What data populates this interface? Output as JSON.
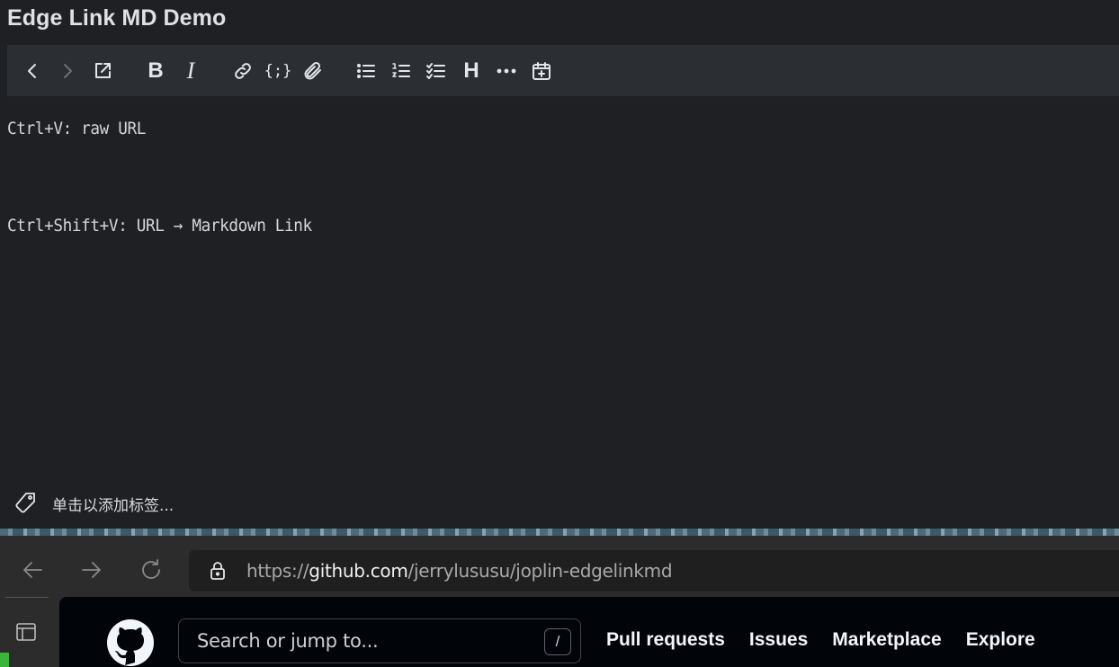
{
  "note": {
    "title": "Edge Link MD Demo",
    "lines": [
      "Ctrl+V: raw URL",
      "Ctrl+Shift+V: URL → Markdown Link"
    ],
    "tag_placeholder": "单击以添加标签..."
  },
  "toolbar": {
    "buttons": [
      {
        "name": "back",
        "icon": "chevron-left-icon",
        "enabled": true
      },
      {
        "name": "forward",
        "icon": "chevron-right-icon",
        "enabled": false
      },
      {
        "name": "open-external",
        "icon": "external-link-icon",
        "enabled": true
      },
      {
        "name": "bold",
        "icon": "bold-icon",
        "glyph": "B"
      },
      {
        "name": "italic",
        "icon": "italic-icon",
        "glyph": "I"
      },
      {
        "name": "link",
        "icon": "link-icon"
      },
      {
        "name": "code",
        "icon": "code-icon",
        "glyph": "{;}"
      },
      {
        "name": "attach",
        "icon": "paperclip-icon"
      },
      {
        "name": "bullet-list",
        "icon": "bullet-list-icon"
      },
      {
        "name": "numbered-list",
        "icon": "numbered-list-icon"
      },
      {
        "name": "checklist",
        "icon": "checklist-icon"
      },
      {
        "name": "heading",
        "icon": "heading-icon",
        "glyph": "H"
      },
      {
        "name": "horizontal-rule",
        "icon": "ellipsis-icon"
      },
      {
        "name": "insert-datetime",
        "icon": "calendar-plus-icon"
      }
    ]
  },
  "browser": {
    "url_prefix": "https://",
    "url_host": "github.com",
    "url_path": "/jerrylususu/joplin-edgelinkmd",
    "search_placeholder": "Search or jump to...",
    "search_shortcut": "/",
    "nav_links": [
      "Pull requests",
      "Issues",
      "Marketplace",
      "Explore"
    ]
  },
  "colors": {
    "editor_bg": "#1e2024",
    "toolbar_bg": "#2b2e33",
    "github_bg": "#010409",
    "browser_chrome": "#2c2c2c"
  }
}
